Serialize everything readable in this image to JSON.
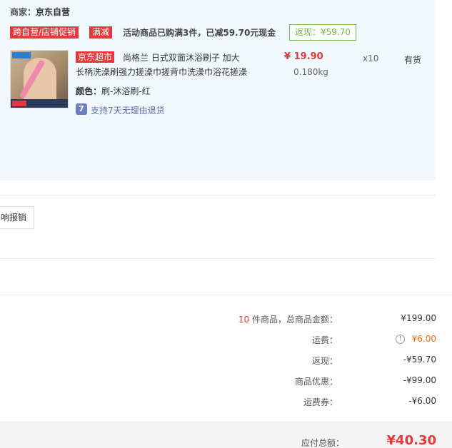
{
  "seller": {
    "label": "商家：",
    "name": "京东自营"
  },
  "promo": {
    "tag_store": "跨自营/店铺促销",
    "tag_discount": "满减",
    "text": "活动商品已购满3件，已减59.70元现金",
    "rebate": "返现：¥59.70"
  },
  "product": {
    "jd_tag": "京东超市",
    "title_line1": "尚格兰 日式双面沐浴刷子 加大",
    "title_line2": "长柄洗澡刷强力搓澡巾搓背巾洗澡巾浴花搓澡",
    "price": "¥ 19.90",
    "weight": "0.180kg",
    "quantity": "x10",
    "stock": "有货",
    "color_label": "颜色：",
    "color_value": "刷-沐浴刷-红",
    "return_icon": "7",
    "return_policy": "支持7天无理由退货",
    "icons": {
      "image": "product-thumbnail",
      "return": "seven-day-return-icon"
    }
  },
  "invoice": {
    "button": "响报销"
  },
  "summary": {
    "count": "10",
    "count_suffix": " 件商品，总商品金额：",
    "goods_total": "¥199.00",
    "shipping_label": "运费：",
    "shipping_value": "¥6.00",
    "shipping_icon": "!",
    "rebate_label": "返现：",
    "rebate_value": "-¥59.70",
    "discount_label": "商品优惠：",
    "discount_value": "-¥99.00",
    "coupon_label": "运费券：",
    "coupon_value": "-¥6.00"
  },
  "total": {
    "label": "应付总额：",
    "value": "¥40.30"
  },
  "colors": {
    "accent": "#e4393c",
    "rebate_green": "#6dbb46",
    "panel_bg": "#f2f9fe",
    "orange": "#ff6600"
  }
}
